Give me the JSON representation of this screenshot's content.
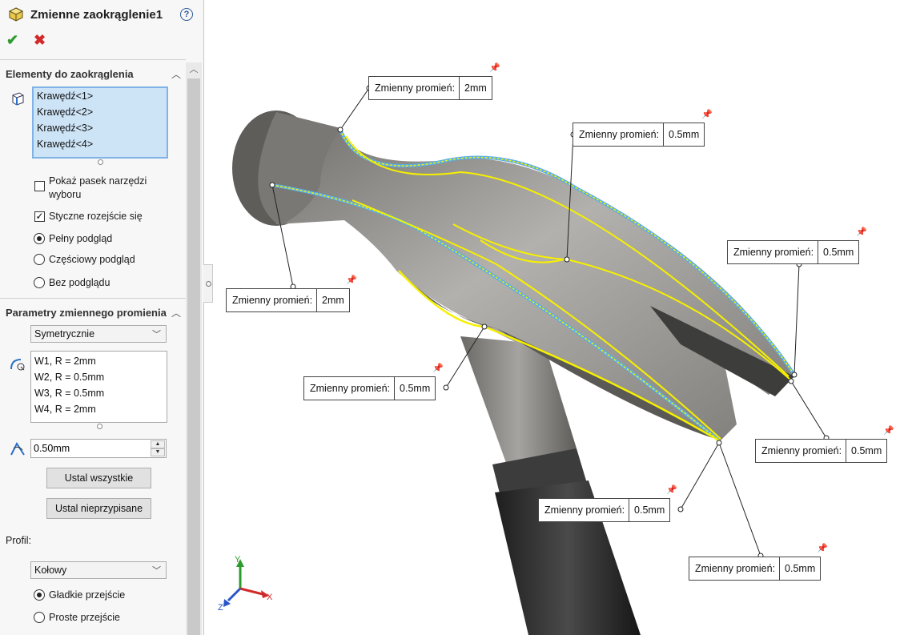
{
  "feature": {
    "title": "Zmienne zaokrąglenie1",
    "help": "?",
    "ok": "✔",
    "cancel": "✖"
  },
  "section1": {
    "title": "Elementy do zaokrąglenia",
    "edges": [
      "Krawędź<1>",
      "Krawędź<2>",
      "Krawędź<3>",
      "Krawędź<4>"
    ],
    "show_toolbar": "Pokaż pasek narzędzi wyboru",
    "tangent": "Styczne rozejście się",
    "full_preview": "Pełny podgląd",
    "partial_preview": "Częściowy podgląd",
    "no_preview": "Bez podglądu"
  },
  "section2": {
    "title": "Parametry zmiennego promienia",
    "type_select": "Symetrycznie",
    "radii": [
      "W1, R = 2mm",
      "W2, R = 0.5mm",
      "W3, R = 0.5mm",
      "W4, R = 2mm"
    ],
    "radius_value": "0.50mm",
    "set_all": "Ustal wszystkie",
    "set_unassigned": "Ustal nieprzypisane",
    "profile_label": "Profil:",
    "profile_select": "Kołowy",
    "smooth": "Gładkie przejście",
    "straight": "Proste przejście"
  },
  "callouts": [
    {
      "label": "Zmienny promień:",
      "value": "2mm"
    },
    {
      "label": "Zmienny promień:",
      "value": "0.5mm"
    },
    {
      "label": "Zmienny promień:",
      "value": "0.5mm"
    },
    {
      "label": "Zmienny promień:",
      "value": "2mm"
    },
    {
      "label": "Zmienny promień:",
      "value": "0.5mm"
    },
    {
      "label": "Zmienny promień:",
      "value": "0.5mm"
    },
    {
      "label": "Zmienny promień:",
      "value": "0.5mm"
    },
    {
      "label": "Zmienny promień:",
      "value": "0.5mm"
    }
  ],
  "triad": {
    "x": "X",
    "y": "Y",
    "z": "Z"
  },
  "colors": {
    "highlight": "#f6f000",
    "edge_blue": "#5aaee6",
    "model_gray": "#8c8a86"
  },
  "icons": [
    "fillet-feature-icon",
    "help-icon",
    "ok-icon",
    "cancel-icon",
    "edge-selection-icon",
    "radius-icon",
    "distance-icon",
    "pin-icon"
  ]
}
